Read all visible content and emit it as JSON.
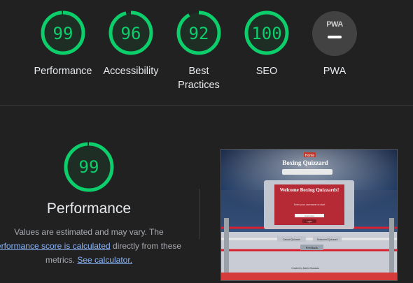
{
  "scores": [
    {
      "label": "Performance",
      "value": "99",
      "fraction": 0.99,
      "color": "#0cce6b"
    },
    {
      "label": "Accessibility",
      "value": "96",
      "fraction": 0.96,
      "color": "#0cce6b"
    },
    {
      "label": "Best Practices",
      "value": "92",
      "fraction": 0.92,
      "color": "#0cce6b"
    },
    {
      "label": "SEO",
      "value": "100",
      "fraction": 1.0,
      "color": "#0cce6b"
    }
  ],
  "pwa": {
    "label": "PWA",
    "badge_text": "PWA"
  },
  "performance": {
    "value": "99",
    "fraction": 0.99,
    "title": "Performance",
    "desc_line1": "Values are estimated and may vary. The",
    "desc_link1": "erformance score is calculated",
    "desc_mid": "directly from these",
    "desc_line3": "metrics.",
    "desc_link2": "See calculator."
  },
  "screenshot": {
    "badge": "Home",
    "site_title": "Boxing Quizzard",
    "card_title": "Welcome Boxing Quizzards!",
    "card_sub": "Enter your username to start",
    "input_placeholder": "Username",
    "start_label": "Login",
    "btn_left": "Casual Quizzard",
    "btn_right": "Seasoned Quizzard",
    "feedback": "Feedback",
    "footer": "Created by Martin Kilanasta"
  },
  "colors": {
    "good": "#0cce6b",
    "background": "#212121",
    "link": "#8ab4f8"
  }
}
